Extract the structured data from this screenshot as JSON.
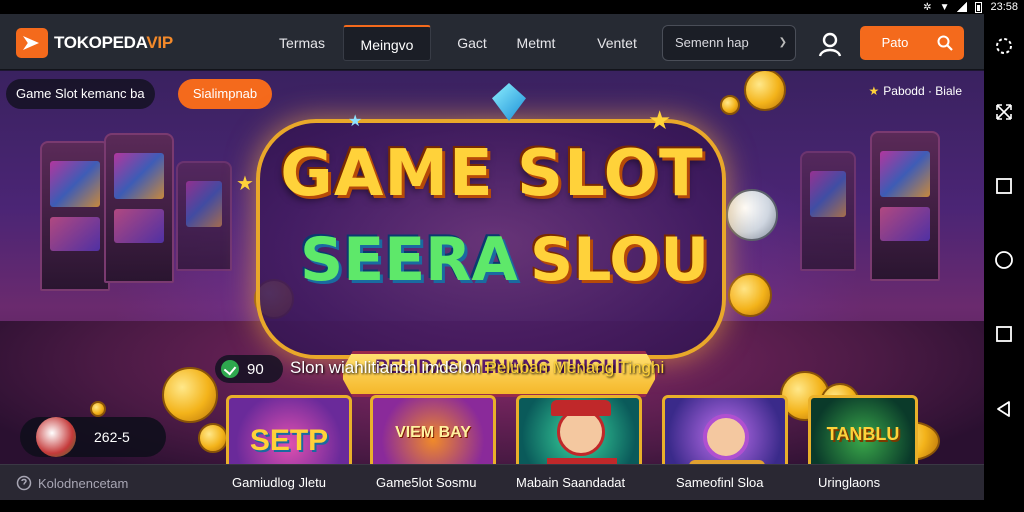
{
  "status_bar": {
    "time": "23:58"
  },
  "header": {
    "brand_main": "TOKOPEDA",
    "brand_accent": "VIP",
    "nav": [
      "Termas",
      "Meingvo",
      "Gact",
      "Metmt",
      "Ventet"
    ],
    "active_nav_index": 1,
    "search_placeholder": "Semenn hap",
    "cta_label": "Pato"
  },
  "hero": {
    "pill_left": "Game Slot kemanc ba",
    "pill_button": "Sialimpnab",
    "top_right_text": "Pabodd · Biale",
    "title_line1": "GAME SLOT",
    "title_line2_a": "SEERA",
    "title_line2_b": "SLOU",
    "ribbon": "PELIDAS MENANG TINGHI",
    "promo_badge": "90",
    "promo_text_a": "Slon wiahlitianch imdelon ",
    "promo_text_b": "Peluban Menang Tinghi",
    "balance": "262-5"
  },
  "cards": [
    {
      "label": "SETP"
    },
    {
      "label": "VIEM BAY"
    },
    {
      "label": ""
    },
    {
      "label": ""
    },
    {
      "label": "TANBLU"
    }
  ],
  "bottom_bar": {
    "left_label": "Kolodnencetam",
    "tabs": [
      "Gamiudlog Jletu",
      "Game5lot Sosmu",
      "Mabain Saandadat",
      "Sameofinl Sloa",
      "Uringlaons"
    ]
  },
  "colors": {
    "accent": "#f46a1c",
    "topbar": "#262a33",
    "gold": "#ffd23a",
    "bottombar": "#2a2833"
  },
  "icons": [
    "user-icon",
    "search-icon",
    "check-icon",
    "rotate-icon",
    "expand-icon",
    "square-icon",
    "home-icon",
    "back-icon"
  ]
}
